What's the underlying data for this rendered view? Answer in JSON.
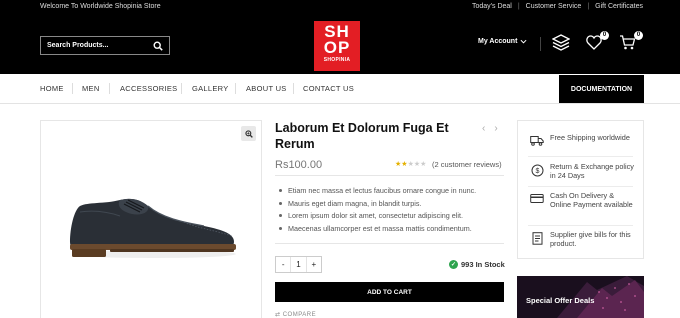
{
  "topbar": {
    "welcome": "Welcome To Worldwide Shopinia Store",
    "links": [
      "Today's Deal",
      "Customer Service",
      "Gift Certificates"
    ]
  },
  "header": {
    "search_placeholder": "Search Products...",
    "logo": {
      "line1": "SH",
      "line2": "OP",
      "tagline": "SHOPINIA"
    },
    "account_label": "My Account",
    "wishlist_count": "0",
    "cart_count": "0"
  },
  "nav": {
    "items": [
      "HOME",
      "MEN",
      "ACCESSORIES",
      "GALLERY",
      "ABOUT US",
      "CONTACT US"
    ],
    "documentation": "DOCUMENTATION"
  },
  "product": {
    "title": "Laborum Et Dolorum Fuga Et Rerum",
    "price": "Rs100.00",
    "rating": 2,
    "rating_max": 5,
    "reviews": "(2 customer reviews)",
    "bullets": [
      "Etiam nec massa et lectus faucibus ornare congue in nunc.",
      "Mauris eget diam magna, in blandit turpis.",
      "Lorem ipsum dolor sit amet, consectetur adipiscing elit.",
      "Maecenas ullamcorper est et massa mattis condimentum."
    ],
    "quantity": "1",
    "qty_minus": "-",
    "qty_plus": "+",
    "stock": "993 In Stock",
    "add_to_cart": "ADD TO CART",
    "compare": "COMPARE"
  },
  "features": [
    {
      "icon": "truck-icon",
      "text": "Free Shipping worldwide"
    },
    {
      "icon": "exchange-icon",
      "text": "Return & Exchange policy in 24 Days"
    },
    {
      "icon": "card-icon",
      "text": "Cash On Delivery & Online Payment available"
    },
    {
      "icon": "bill-icon",
      "text": "Supplier give bills for this product."
    }
  ],
  "offer": {
    "title": "Special Offer Deals"
  },
  "colors": {
    "brand_red": "#e31e24",
    "header_bg": "#000000",
    "stock_green": "#2ea44f",
    "star": "#e4b100"
  }
}
